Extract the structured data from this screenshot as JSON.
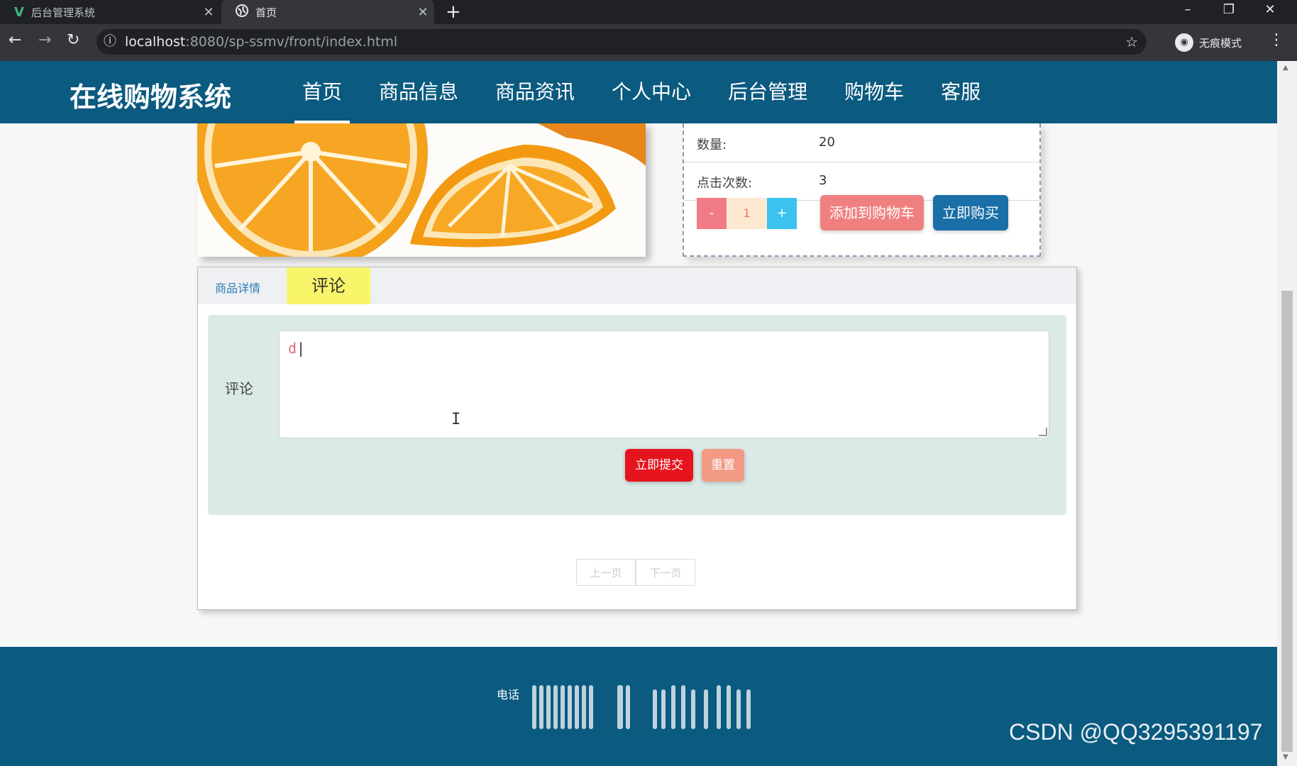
{
  "browser": {
    "tabs": [
      {
        "title": "后台管理系统",
        "active": false,
        "icon": "vue-logo-icon"
      },
      {
        "title": "首页",
        "active": true,
        "icon": "globe-icon"
      }
    ],
    "new_tab": "+",
    "url_host": "localhost",
    "url_rest": ":8080/sp-ssmv/front/index.html",
    "incognito_label": "无痕模式"
  },
  "header": {
    "brand": "在线购物系统",
    "menu": [
      {
        "label": "首页",
        "active": true
      },
      {
        "label": "商品信息",
        "active": false
      },
      {
        "label": "商品资讯",
        "active": false
      },
      {
        "label": "个人中心",
        "active": false
      },
      {
        "label": "后台管理",
        "active": false
      },
      {
        "label": "购物车",
        "active": false
      },
      {
        "label": "客服",
        "active": false
      }
    ]
  },
  "product": {
    "image_subject": "orange slices",
    "fields": [
      {
        "key": "数量:",
        "value": "20"
      },
      {
        "key": "点击次数:",
        "value": "3"
      }
    ],
    "quantity": "1",
    "minus": "-",
    "plus": "+",
    "add_to_cart": "添加到购物车",
    "buy_now": "立即购买"
  },
  "detail": {
    "tab_detail": "商品详情",
    "tab_comment": "评论",
    "comment_label": "评论",
    "comment_value": "d",
    "submit": "立即提交",
    "reset": "重置",
    "prev_page": "上一页",
    "next_page": "下一页"
  },
  "footer": {
    "text": "电话"
  },
  "watermark": "CSDN @QQ3295391197",
  "colors": {
    "header_bg": "#0b5a80",
    "submit": "#e6141d",
    "reset": "#f29a83",
    "cart": "#f08080",
    "buy": "#1b6fa8",
    "tab_active": "#f9f56a"
  }
}
